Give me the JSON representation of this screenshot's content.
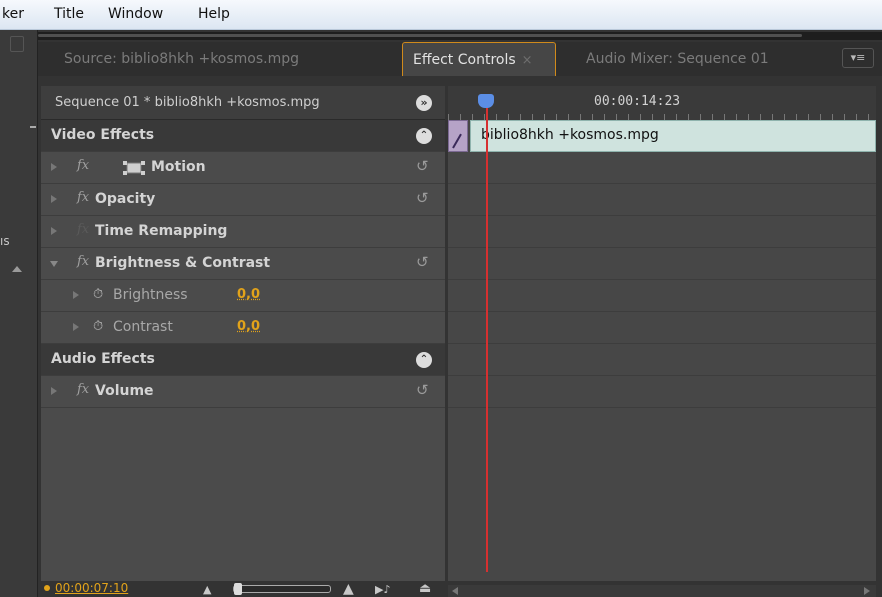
{
  "menubar": {
    "items": [
      "ker",
      "Title",
      "Window",
      "Help"
    ]
  },
  "leftstub": {
    "label": "ıs"
  },
  "tabs": [
    {
      "label": "Source: biblio8hkh +kosmos.mpg",
      "active": false
    },
    {
      "label": "Effect Controls",
      "active": true,
      "close": "×"
    },
    {
      "label": "Audio Mixer: Sequence 01",
      "active": false
    }
  ],
  "tab_menu": "▾≡",
  "effect_controls": {
    "sequence_title": "Sequence 01 * biblio8hkh +kosmos.mpg",
    "sections": {
      "video": "Video Effects",
      "audio": "Audio Effects"
    },
    "effects": {
      "motion": "Motion",
      "opacity": "Opacity",
      "time_remapping": "Time Remapping",
      "brightness_contrast": "Brightness & Contrast",
      "volume": "Volume"
    },
    "properties": {
      "brightness": {
        "label": "Brightness",
        "value": "0,0"
      },
      "contrast": {
        "label": "Contrast",
        "value": "0,0"
      }
    },
    "fx_symbol": "fx",
    "reset_symbol": "↺",
    "stopwatch_symbol": "⏱"
  },
  "timeline": {
    "timecode": "00:00:14:23",
    "clip_name": "biblio8hkh +kosmos.mpg"
  },
  "bottom": {
    "current_time": "00:00:07:10",
    "zoom_slider": 0.0
  },
  "colors": {
    "accent": "#e2a31a",
    "playhead": "#d63030",
    "clip": "#cfe3de",
    "active_tab_border": "#d08a1b"
  }
}
